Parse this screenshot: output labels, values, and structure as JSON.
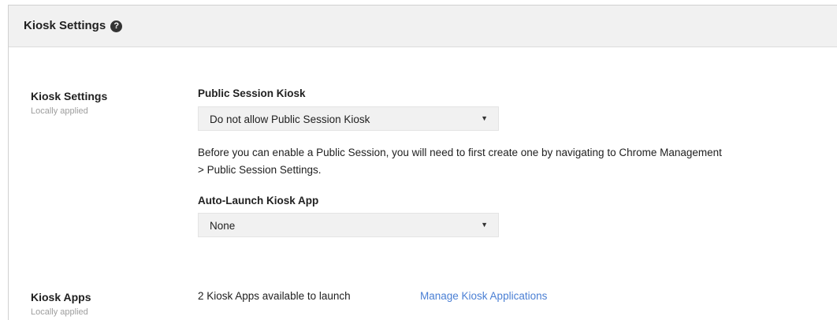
{
  "header": {
    "title": "Kiosk Settings",
    "help_icon": "question-circle-icon"
  },
  "kiosk_settings": {
    "label": "Kiosk Settings",
    "sublabel": "Locally applied",
    "public_session": {
      "label": "Public Session Kiosk",
      "selected": "Do not allow Public Session Kiosk"
    },
    "help_line1": "Before you can enable a Public Session, you will need to first create one by navigating to Chrome Management",
    "help_line2": "> Public Session Settings.",
    "auto_launch": {
      "label": "Auto-Launch Kiosk App",
      "selected": "None"
    }
  },
  "kiosk_apps": {
    "label": "Kiosk Apps",
    "sublabel": "Locally applied",
    "count_text": "2 Kiosk Apps available to launch",
    "manage_link": "Manage Kiosk Applications"
  }
}
